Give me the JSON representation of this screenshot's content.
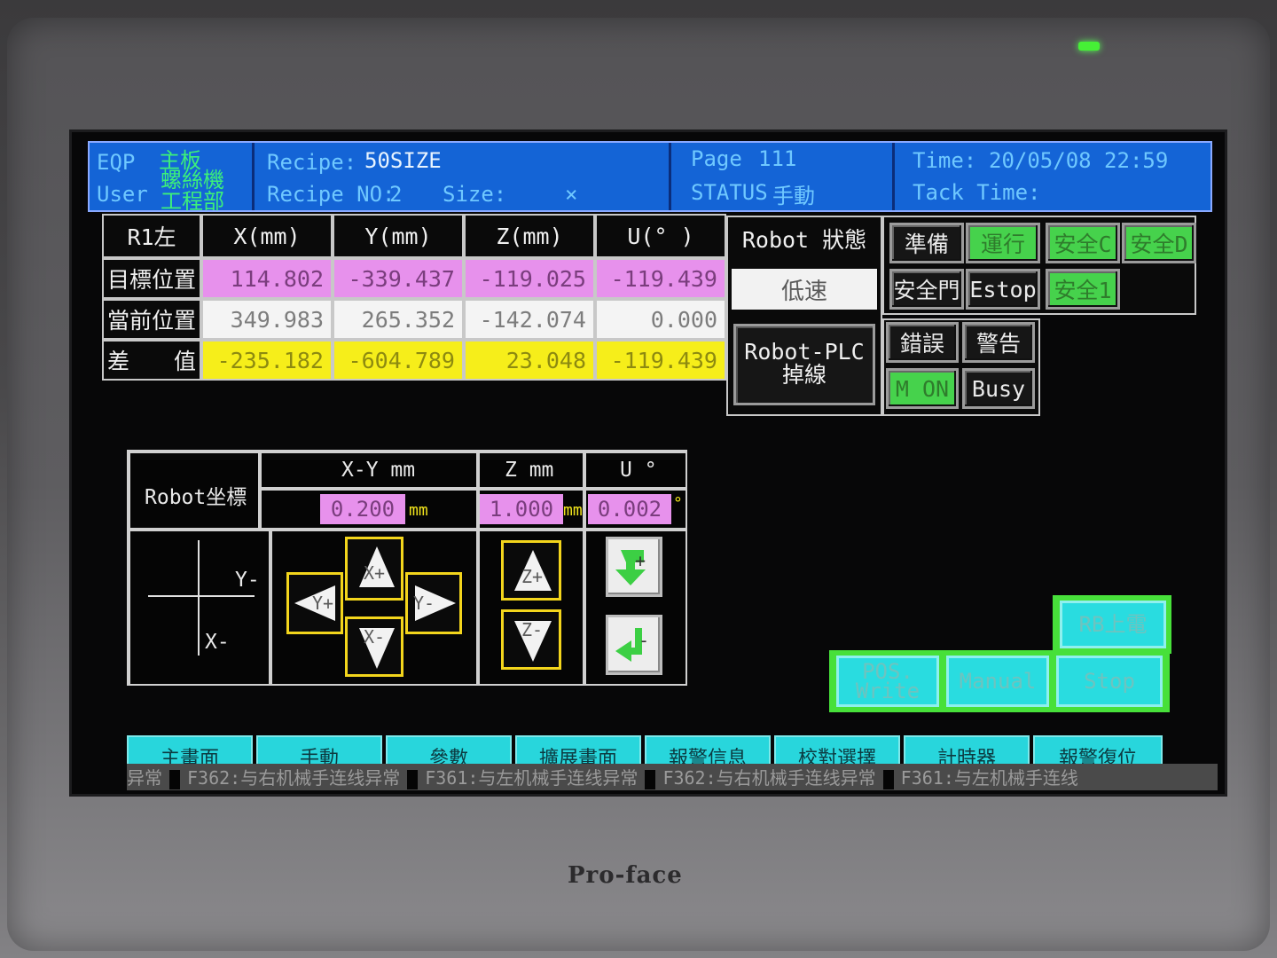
{
  "header": {
    "eqp_label": "EQP",
    "user_label": "User",
    "eqp_value": "主板",
    "user_value_1": "螺絲機",
    "user_value_2": "工程部",
    "recipe_label": "Recipe:",
    "recipe_value": "50SIZE",
    "recipe_no_label": "Recipe NO:",
    "recipe_no_value": "2",
    "size_label": "Size:",
    "size_value": "×",
    "page_label": "Page",
    "page_value": "111",
    "status_label": "STATUS",
    "status_value": "手動",
    "time_label": "Time:",
    "time_value": "20/05/08 22:59",
    "tack_label": "Tack Time:"
  },
  "position_table": {
    "corner": "R1左",
    "columns": [
      "X(mm)",
      "Y(mm)",
      "Z(mm)",
      "U(° )"
    ],
    "rows": [
      {
        "label": "目標位置",
        "values": [
          "114.802",
          "-339.437",
          "-119.025",
          "-119.439"
        ]
      },
      {
        "label": "當前位置",
        "values": [
          "349.983",
          "265.352",
          "-142.074",
          "0.000"
        ]
      },
      {
        "label": "差　　值",
        "values": [
          "-235.182",
          "-604.789",
          "23.048",
          "-119.439"
        ]
      }
    ]
  },
  "robot_status": {
    "title": "Robot 狀態",
    "speed": "低速",
    "plc_line1": "Robot-PLC",
    "plc_line2": "掉線"
  },
  "status_buttons": {
    "ready": "準備",
    "run": "運行",
    "safe_c": "安全C",
    "safe_d": "安全D",
    "safe_door": "安全門",
    "estop": "Estop",
    "safe_1": "安全1",
    "error": "錯誤",
    "warning": "警告",
    "m_on": "M ON",
    "busy": "Busy"
  },
  "jog": {
    "title": "Robot坐標",
    "xy_header": "X-Y mm",
    "z_header": "Z mm",
    "u_header": "U °",
    "xy_step": "0.200",
    "z_step": "1.000",
    "u_step": "0.002",
    "unit_mm": "mm",
    "unit_deg": "°",
    "axis_y": "Y-",
    "axis_x": "X-",
    "btn_x_plus": "X+",
    "btn_x_minus": "X-",
    "btn_y_plus": "Y+",
    "btn_y_minus": "Y-",
    "btn_z_plus": "Z+",
    "btn_z_minus": "Z-",
    "btn_u_plus": "+",
    "btn_u_minus": "-"
  },
  "control_buttons": {
    "rb_power": "RB上電",
    "pos_write_1": "POS.",
    "pos_write_2": "Write",
    "manual": "Manual",
    "stop": "Stop"
  },
  "tabs": [
    "主畫面",
    "手動",
    "參數",
    "擴展畫面",
    "報警信息",
    "校對選擇",
    "計時器",
    "報警復位"
  ],
  "ticker": {
    "prefix": "异常",
    "messages": [
      "F362:与右机械手连线异常",
      "F361:与左机械手连线异常",
      "F362:与右机械手连线异常",
      "F361:与左机械手连线"
    ]
  },
  "device": {
    "brand": "Pro-face"
  },
  "colors": {
    "header_bg": "#1464d6",
    "target_row": "#e791ec",
    "diff_row": "#f6ee1a",
    "active_green": "#46d24c",
    "tab_cyan": "#28d6dc"
  }
}
